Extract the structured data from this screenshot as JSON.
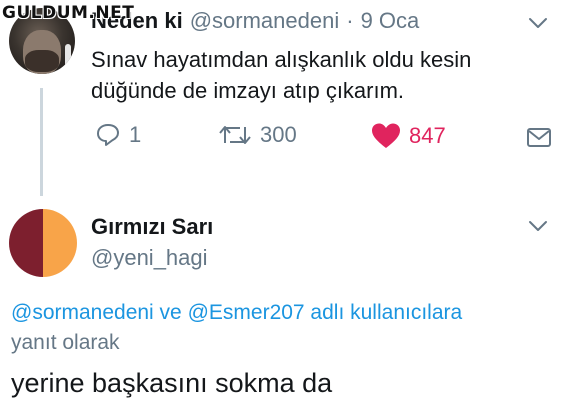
{
  "watermark": "GULDUM.NET",
  "tweet": {
    "author_name": "Neden ki",
    "author_handle": "@sormanedeni",
    "separator": "·",
    "date": "9 Oca",
    "text_line1": "Sınav hayatımdan alışkanlık oldu kesin",
    "text_line2": "düğünde de imzayı atıp çıkarım.",
    "replies": "1",
    "retweets": "300",
    "likes": "847",
    "colors": {
      "like": "#e0245e",
      "muted": "#657786"
    },
    "icons": [
      "reply-icon",
      "retweet-icon",
      "heart-icon",
      "message-icon",
      "chevron-down-icon"
    ]
  },
  "reply": {
    "author_name": "Gırmızı Sarı",
    "author_handle": "@yeni_hagi",
    "replying_to_line1": "@sormanedeni ve @Esmer207 adlı kullanıcılara",
    "replying_to_line2": "yanıt olarak",
    "text": "yerine başkasını sokma da",
    "colors": {
      "link": "#1b95e0"
    }
  }
}
